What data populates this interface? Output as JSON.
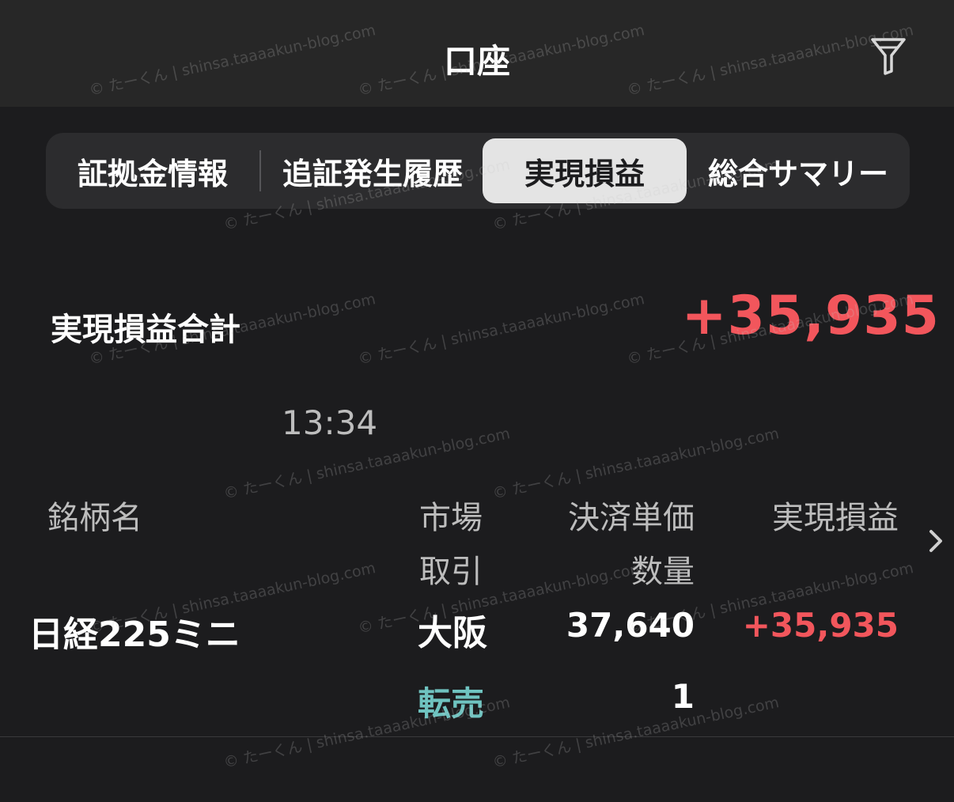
{
  "header": {
    "title": "口座",
    "filter_icon": "filter-icon"
  },
  "tabs": [
    {
      "label": "証拠金情報",
      "active": false
    },
    {
      "label": "追証発生履歴",
      "active": false
    },
    {
      "label": "実現損益",
      "active": true
    },
    {
      "label": "総合サマリー",
      "active": false
    }
  ],
  "summary": {
    "total_label": "実現損益合計",
    "total_value": "+35,935",
    "time": "13:34"
  },
  "table": {
    "columns": {
      "name": "銘柄名",
      "market": "市場",
      "trade": "取引",
      "price": "決済単価",
      "quantity": "数量",
      "pnl": "実現損益"
    },
    "rows": [
      {
        "name": "日経225ミニ",
        "market": "大阪",
        "price": "37,640",
        "pnl": "+35,935",
        "trade": "転売",
        "quantity": "1"
      }
    ]
  },
  "watermark": "© たーくん | shinsa.taaaakun-blog.com",
  "colors": {
    "background": "#1c1c1e",
    "header": "#272727",
    "positive": "#f2565c",
    "trade_type": "#6fc3c0",
    "active_tab": "#e4e4e4"
  }
}
